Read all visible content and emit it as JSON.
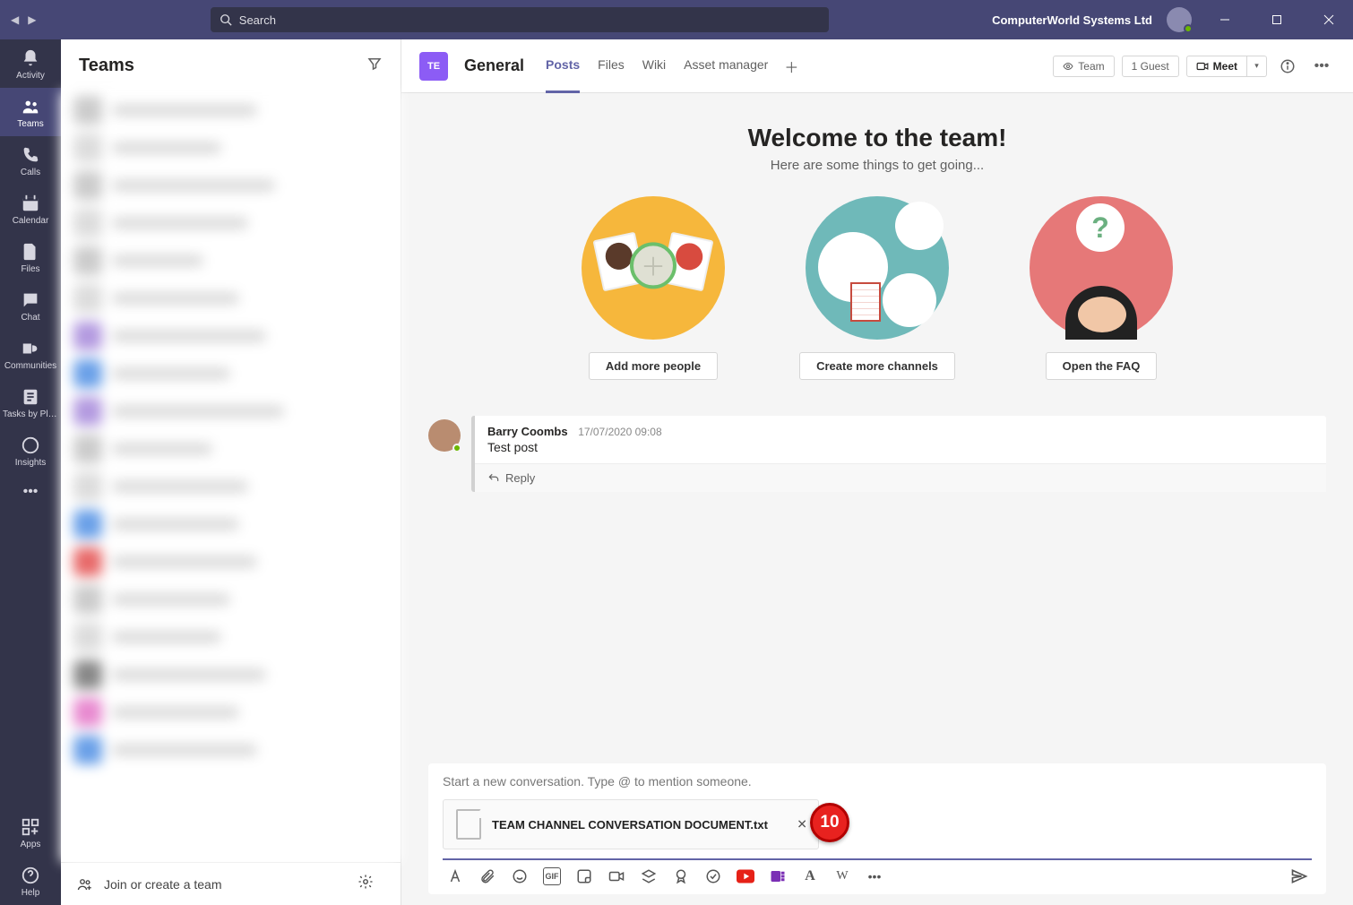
{
  "titlebar": {
    "search_placeholder": "Search",
    "org": "ComputerWorld Systems Ltd"
  },
  "rail": {
    "items": [
      {
        "id": "activity",
        "label": "Activity"
      },
      {
        "id": "teams",
        "label": "Teams"
      },
      {
        "id": "calls",
        "label": "Calls"
      },
      {
        "id": "calendar",
        "label": "Calendar"
      },
      {
        "id": "files",
        "label": "Files"
      },
      {
        "id": "chat",
        "label": "Chat"
      },
      {
        "id": "communities",
        "label": "Communities"
      },
      {
        "id": "tasks",
        "label": "Tasks by Pla..."
      },
      {
        "id": "insights",
        "label": "Insights"
      }
    ],
    "apps": "Apps",
    "help": "Help"
  },
  "panel": {
    "title": "Teams",
    "join": "Join or create a team"
  },
  "channel": {
    "badge": "TE",
    "name": "General",
    "tabs": [
      "Posts",
      "Files",
      "Wiki",
      "Asset manager"
    ],
    "team_chip": "Team",
    "guest_chip": "1 Guest",
    "meet": "Meet"
  },
  "welcome": {
    "title": "Welcome to the team!",
    "subtitle": "Here are some things to get going...",
    "buttons": [
      "Add more people",
      "Create more channels",
      "Open the FAQ"
    ]
  },
  "message": {
    "author": "Barry Coombs",
    "timestamp": "17/07/2020 09:08",
    "text": "Test post",
    "reply": "Reply"
  },
  "composer": {
    "placeholder": "Start a new conversation. Type @ to mention someone.",
    "attachment": "TEAM CHANNEL CONVERSATION DOCUMENT.txt",
    "badge": "10"
  }
}
